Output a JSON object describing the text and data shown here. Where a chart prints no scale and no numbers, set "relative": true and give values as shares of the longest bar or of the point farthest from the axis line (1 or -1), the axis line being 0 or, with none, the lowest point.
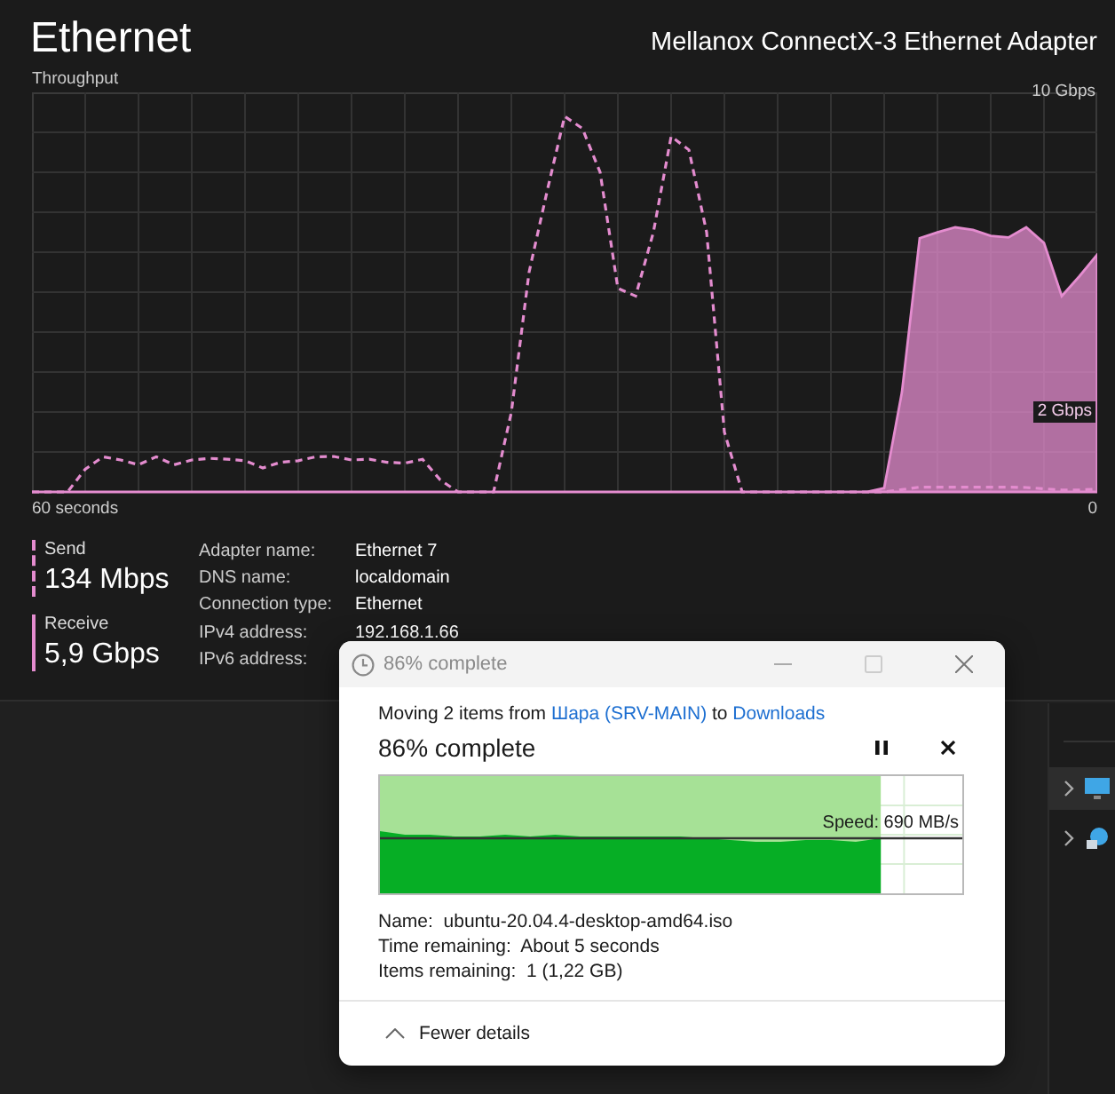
{
  "performance": {
    "title": "Ethernet",
    "adapter": "Mellanox ConnectX-3 Ethernet Adapter",
    "chart": {
      "span_label": "60 seconds",
      "end_label": "0",
      "chart_data": {
        "type": "line",
        "title": "Throughput",
        "ylim": [
          0,
          10
        ],
        "grid": true,
        "yticks": [
          {
            "value": 10,
            "label": "10 Gbps"
          },
          {
            "value": 2,
            "label": "2 Gbps"
          }
        ],
        "categories": [
          null,
          null,
          null,
          null,
          null,
          null,
          null,
          null,
          null,
          null,
          null,
          null,
          null,
          null,
          null,
          null,
          null,
          null,
          null,
          null,
          null,
          null,
          null,
          null,
          null,
          null,
          null,
          null,
          null,
          null,
          null,
          null,
          null,
          null,
          null,
          null,
          null,
          null,
          null,
          null,
          null,
          null,
          null,
          null,
          null,
          null,
          null,
          null,
          null,
          null,
          null,
          null,
          null,
          null,
          null,
          null,
          null,
          null,
          null,
          null,
          null
        ],
        "series": [
          {
            "name": "Send",
            "color": "#e48ccf",
            "line_style": "dashed",
            "values": [
              0,
              0,
              0,
              0.57,
              0.88,
              0.8,
              0.68,
              0.88,
              0.68,
              0.8,
              0.84,
              0.82,
              0.78,
              0.6,
              0.74,
              0.78,
              0.88,
              0.89,
              0.8,
              0.82,
              0.74,
              0.72,
              0.82,
              0.3,
              0,
              0,
              0,
              1.99,
              5.5,
              7.5,
              9.4,
              9.1,
              8,
              5.1,
              4.9,
              6.5,
              8.9,
              8.56,
              6.5,
              1.5,
              0,
              0,
              0,
              0,
              0,
              0,
              0,
              0,
              0,
              0.06,
              0.12,
              0.12,
              0.12,
              0.12,
              0.12,
              0.12,
              0.11,
              0.08,
              0.05,
              0.05,
              0.07
            ]
          }
        ]
      },
      "overlay": {
        "chart_data": {
          "type": "area",
          "relative": true,
          "ylim": [
            0,
            10
          ],
          "categories": [
            null,
            null,
            null,
            null,
            null,
            null,
            null,
            null,
            null,
            null,
            null,
            null,
            null,
            null,
            null,
            null,
            null,
            null,
            null,
            null,
            null,
            null,
            null,
            null,
            null,
            null,
            null,
            null,
            null,
            null,
            null,
            null,
            null,
            null,
            null,
            null,
            null,
            null,
            null,
            null,
            null,
            null,
            null,
            null,
            null,
            null,
            null,
            null,
            null,
            null,
            null,
            null,
            null,
            null,
            null,
            null,
            null,
            null,
            null,
            null,
            null
          ],
          "series": [
            {
              "name": "Receive",
              "color": "#e48ccf",
              "values": [
                0,
                0,
                0,
                0,
                0,
                0,
                0,
                0,
                0,
                0,
                0,
                0,
                0,
                0,
                0,
                0,
                0,
                0,
                0,
                0,
                0,
                0,
                0,
                0,
                0,
                0,
                0,
                0,
                0,
                0,
                0,
                0,
                0,
                0,
                0,
                0,
                0,
                0,
                0,
                0,
                0,
                0,
                0,
                0,
                0,
                0,
                0,
                0,
                0.1,
                2.5,
                6.35,
                6.5,
                6.62,
                6.56,
                6.41,
                6.37,
                6.62,
                6.23,
                4.9,
                5.4,
                5.94
              ]
            }
          ]
        }
      }
    },
    "send": {
      "value": "134 Mbps"
    },
    "receive": {
      "value": "5,9 Gbps"
    },
    "details": [
      {
        "label": "Adapter name:",
        "value": "Ethernet 7"
      },
      {
        "label": "DNS name:",
        "value": "localdomain"
      },
      {
        "label": "Connection type:",
        "value": "Ethernet"
      },
      {
        "label": "IPv4 address:",
        "value": "192.168.1.66"
      },
      {
        "label": "IPv6 address:"
      }
    ]
  },
  "copy_dialog": {
    "title": "86% complete",
    "message": {
      "prefix": "Moving 2 items from",
      "source": "Шара (SRV-MAIN)",
      "joiner": "to",
      "destination": "Downloads"
    },
    "heading": "86% complete",
    "progress": {
      "level": 0.86
    },
    "speed": "Speed: 690 MB/s",
    "details": [
      {
        "label": "Name:",
        "value": "ubuntu-20.04.4-desktop-amd64.iso"
      },
      {
        "label": "Time remaining:",
        "value": "About 5 seconds"
      },
      {
        "label": "Items remaining:",
        "value": "1 (1,22 GB)"
      }
    ],
    "toggle": "Fewer details"
  }
}
